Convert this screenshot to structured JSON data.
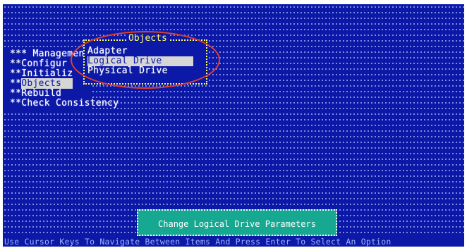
{
  "main_menu": {
    "items": [
      {
        "label": "Managemen",
        "prefix": "*** "
      },
      {
        "label": "Configur",
        "prefix": "**"
      },
      {
        "label": "Initializ",
        "prefix": "**"
      },
      {
        "label": "Objects",
        "prefix": "**",
        "selected": true
      },
      {
        "label": "Rebuild",
        "prefix": "**"
      },
      {
        "label": "Check Consistency",
        "prefix": "**"
      }
    ]
  },
  "objects_window": {
    "title": "Objects",
    "items": [
      {
        "label": "Adapter"
      },
      {
        "label": "Logical Drive",
        "selected": true
      },
      {
        "label": "Physical Drive"
      }
    ]
  },
  "help_box": {
    "text": "Change Logical Drive Parameters"
  },
  "status_bar": {
    "text": "Use Cursor Keys To Navigate Between Items And Press Enter To Select An Option"
  },
  "colors": {
    "background": "#0c18a6",
    "highlight": "#d6d6d6",
    "help_box": "#17a891",
    "circle": "#e0402a",
    "window_border": "#ffff66"
  }
}
